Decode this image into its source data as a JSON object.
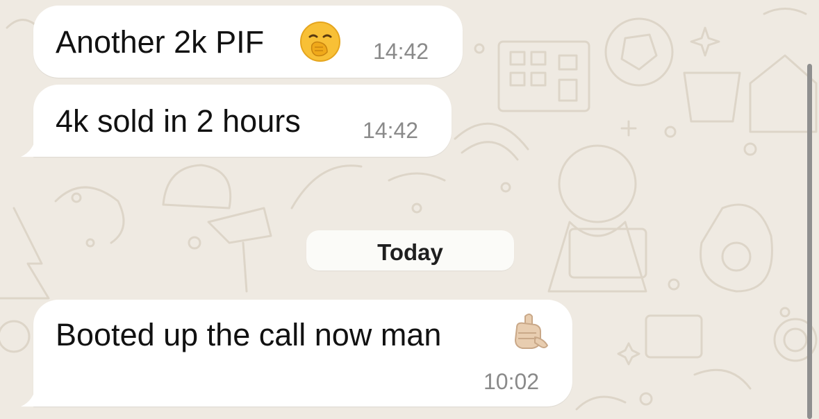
{
  "chat": {
    "messages": [
      {
        "text": "Another 2k PIF",
        "emoji": "yawning-face",
        "time": "14:42"
      },
      {
        "text": "4k sold in 2 hours",
        "time": "14:42"
      },
      {
        "text": "Booted up the call now man",
        "emoji": "call-me-hand-light-skin-tone",
        "time": "10:02"
      }
    ],
    "date_separator": "Today"
  },
  "colors": {
    "wallpaper": "#efeae2",
    "bubble_incoming": "#ffffff",
    "text": "#111111",
    "timestamp": "#8a8a8a"
  }
}
